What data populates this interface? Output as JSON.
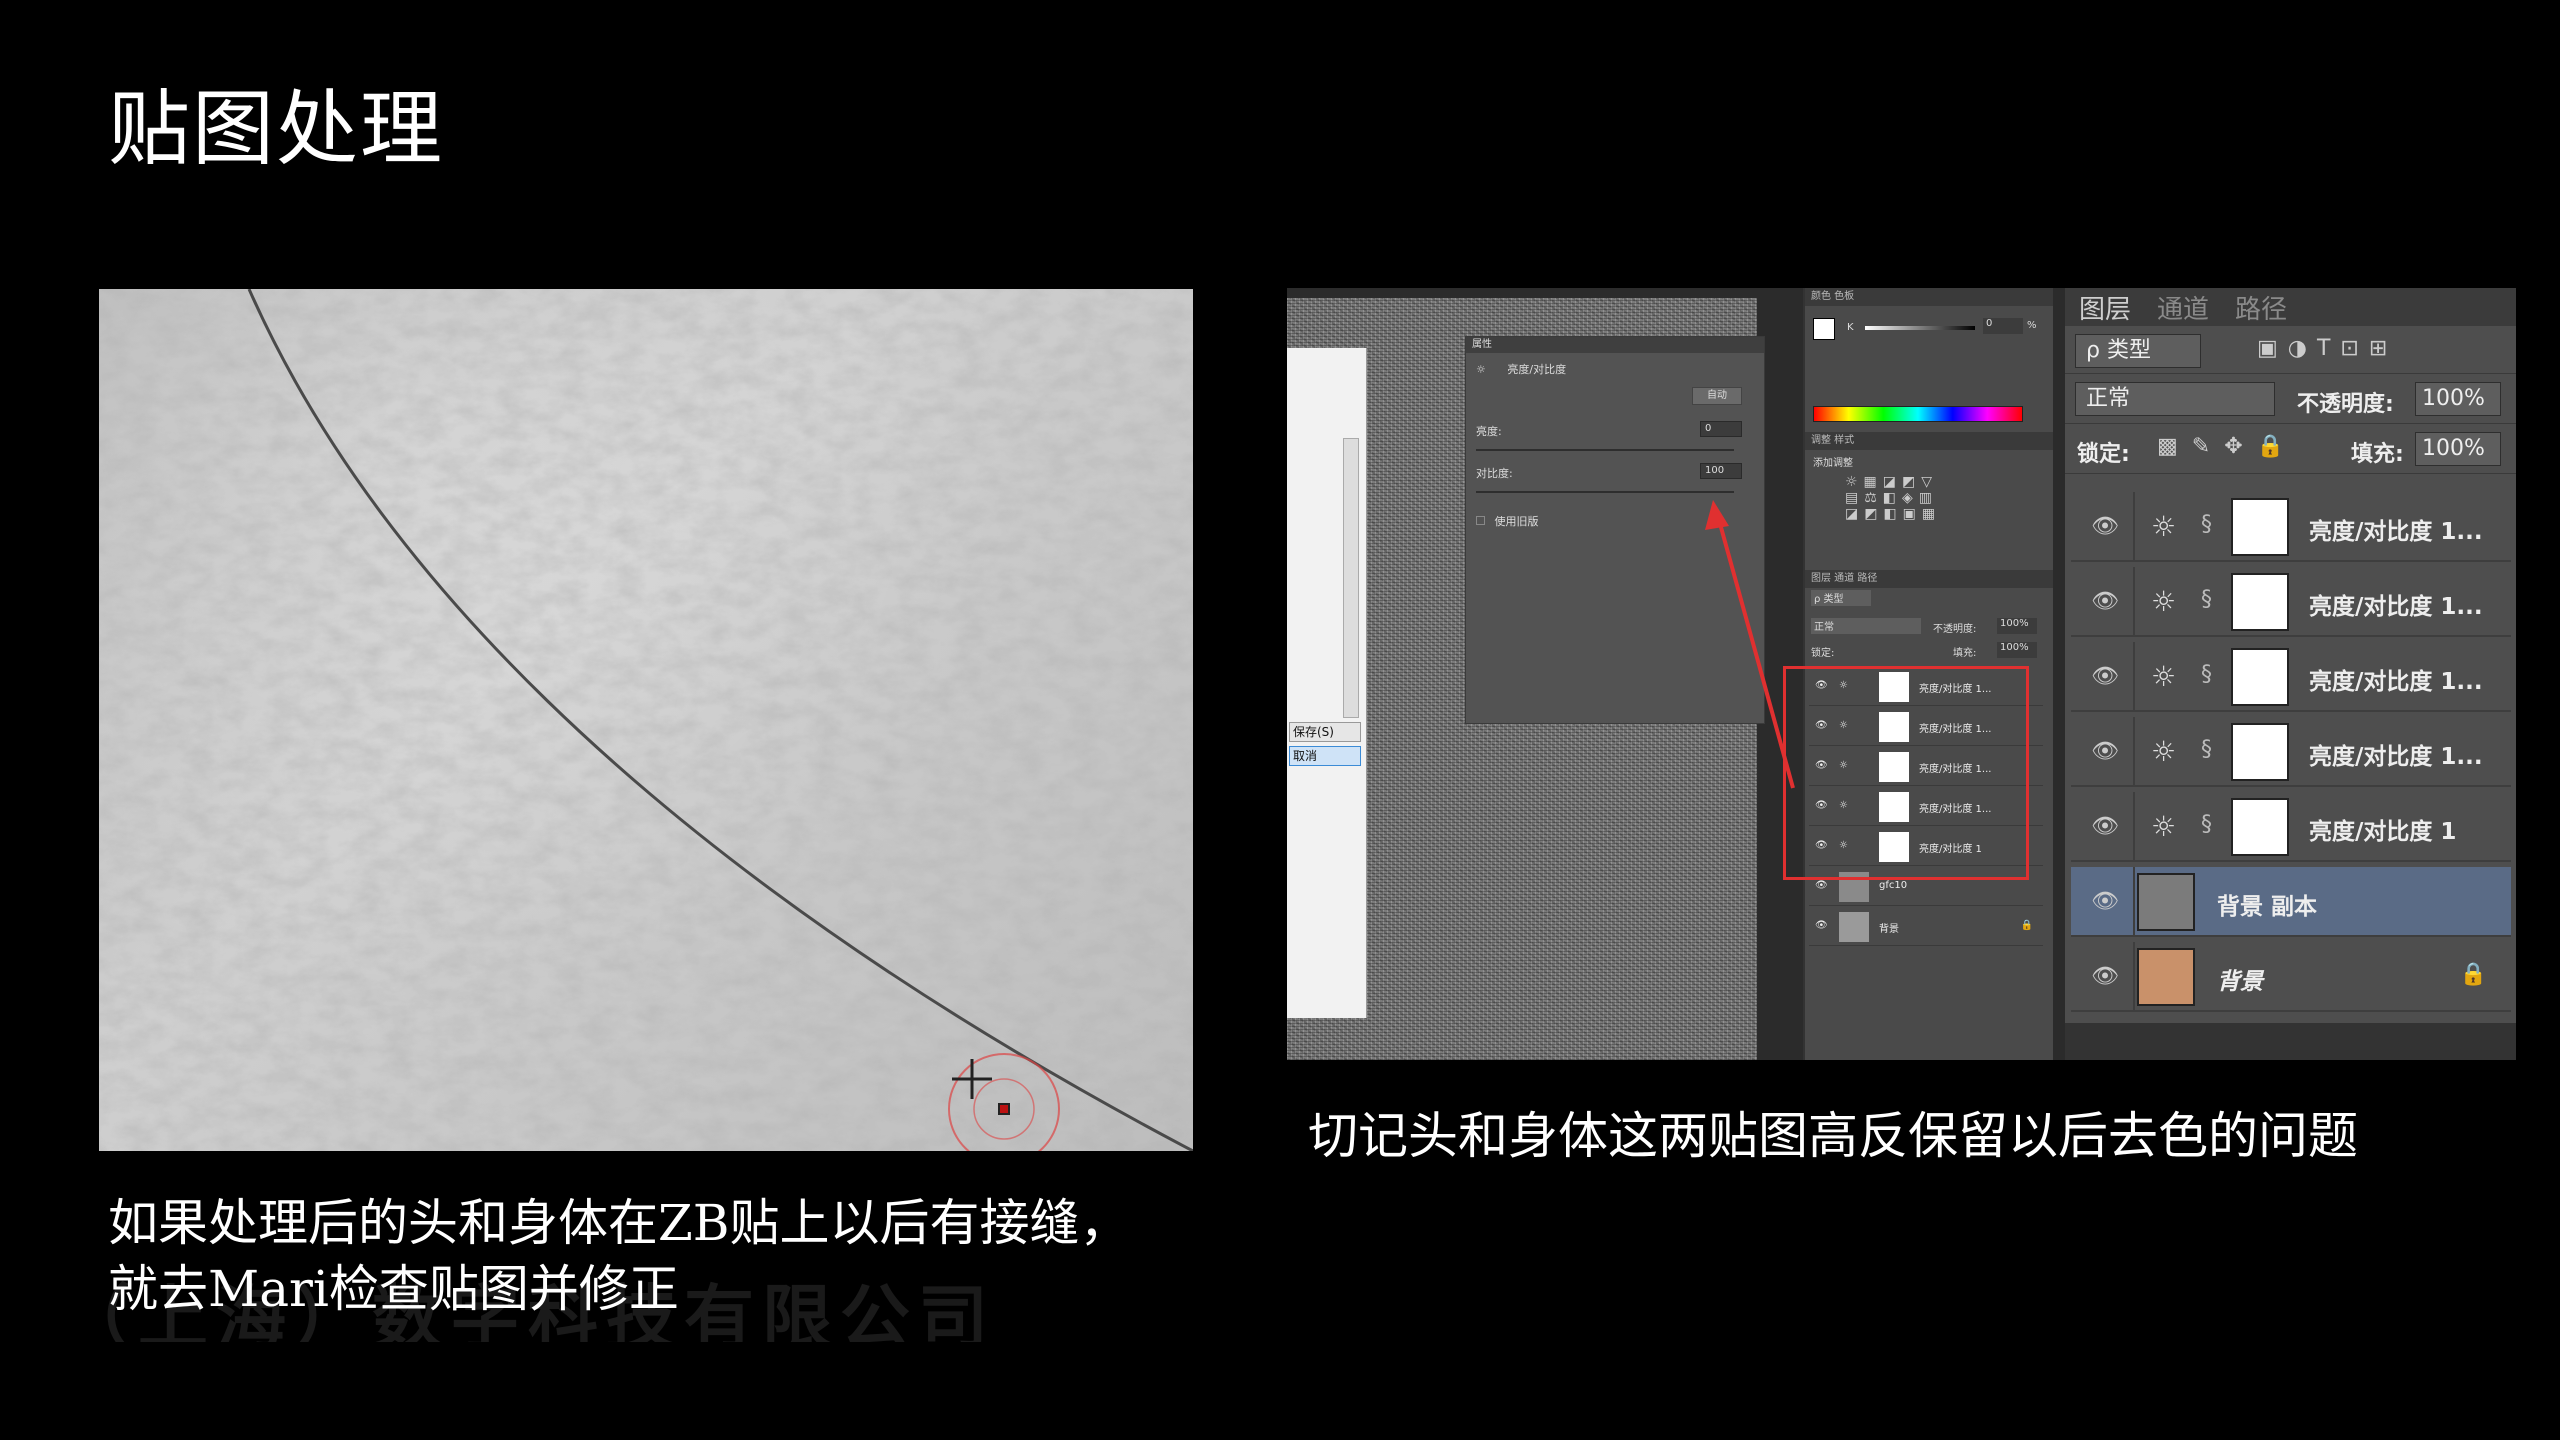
{
  "slide": {
    "title": "贴图处理",
    "left_caption": "如果处理后的头和身体在ZB贴上以后有接缝，\n就去Mari检查贴图并修正",
    "right_caption": "切记头和身体这两贴图高反保留以后去色的问题",
    "watermark": "（上海）数字科技有限公司"
  },
  "photoshop": {
    "dialog_buttons": [
      "保存(S)",
      "取消"
    ],
    "properties": {
      "tab": "属性",
      "adjustment_name": "亮度/对比度",
      "auto_label": "自动",
      "brightness_label": "亮度:",
      "brightness_value": "0",
      "contrast_label": "对比度:",
      "contrast_value": "100",
      "legacy_label": "使用旧版"
    },
    "mid_panel": {
      "color_tabs": "颜色  色板",
      "color_channel": "K",
      "color_value": "0",
      "color_unit": "%",
      "adjust_tabs": "调整  样式",
      "adjust_heading": "添加调整",
      "layers_tabs": "图层  通道  路径",
      "kind_label": "ρ 类型",
      "mode_label": "正常",
      "opacity_label": "不透明度:",
      "opacity_value": "100%",
      "lock_label": "锁定:",
      "fill_label": "填充:",
      "fill_value": "100%",
      "layers": [
        {
          "name": "亮度/对比度 1...",
          "type": "adjustment"
        },
        {
          "name": "亮度/对比度 1...",
          "type": "adjustment"
        },
        {
          "name": "亮度/对比度 1...",
          "type": "adjustment"
        },
        {
          "name": "亮度/对比度 1...",
          "type": "adjustment"
        },
        {
          "name": "亮度/对比度 1",
          "type": "adjustment"
        },
        {
          "name": "gfc10",
          "type": "pixel"
        },
        {
          "name": "背景",
          "type": "background"
        }
      ]
    },
    "layers_panel": {
      "tabs": [
        "图层",
        "通道",
        "路径"
      ],
      "kind_label": "ρ 类型",
      "mode_label": "正常",
      "opacity_label": "不透明度:",
      "opacity_value": "100%",
      "lock_label": "锁定:",
      "fill_label": "填充:",
      "fill_value": "100%",
      "layers": [
        {
          "name": "亮度/对比度 1...",
          "type": "adjustment"
        },
        {
          "name": "亮度/对比度 1...",
          "type": "adjustment"
        },
        {
          "name": "亮度/对比度 1...",
          "type": "adjustment"
        },
        {
          "name": "亮度/对比度 1...",
          "type": "adjustment"
        },
        {
          "name": "亮度/对比度 1",
          "type": "adjustment"
        },
        {
          "name": "背景 副本",
          "type": "pixel",
          "selected": true
        },
        {
          "name": "背景",
          "type": "background",
          "locked": true
        }
      ]
    },
    "colors": {
      "highlight_frame": "#e03030",
      "selected_layer": "#5a6b86",
      "panel_bg": "#4e4e4e"
    }
  }
}
